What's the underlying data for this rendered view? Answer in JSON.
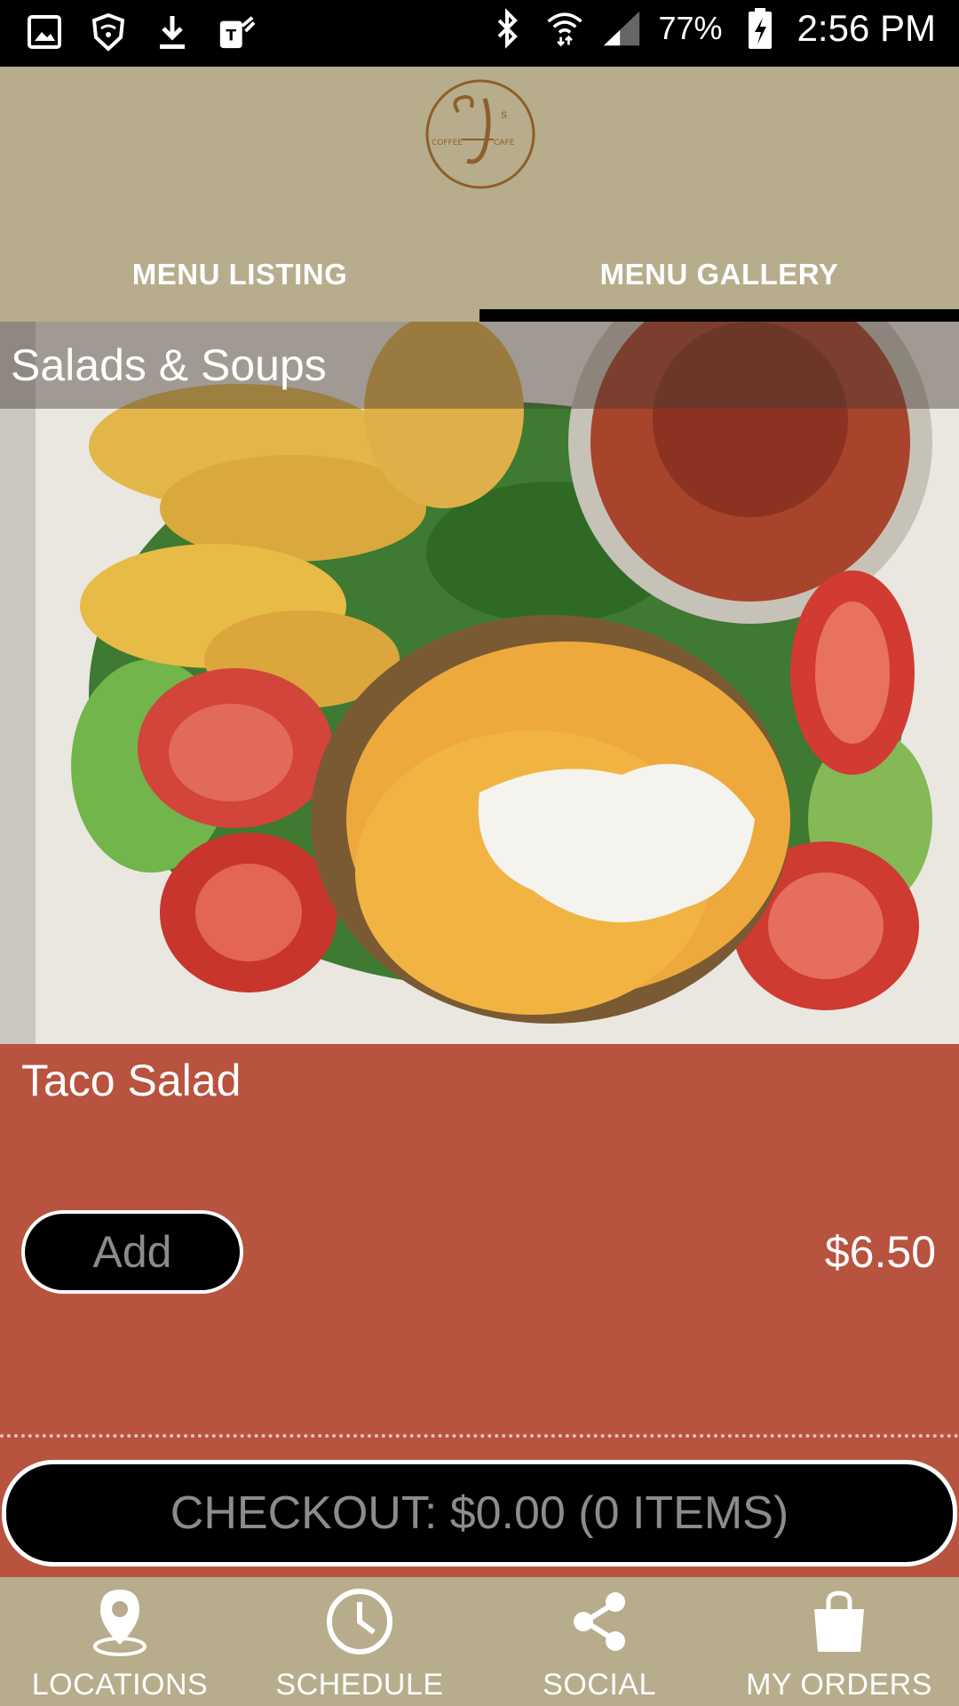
{
  "status_bar": {
    "battery": "77%",
    "time": "2:56 PM"
  },
  "header": {
    "logo_alt": "CJ's Coffee Cafe",
    "tabs": [
      {
        "label": "MENU LISTING",
        "active": false
      },
      {
        "label": "MENU GALLERY",
        "active": true
      }
    ]
  },
  "gallery": {
    "category": "Salads & Soups",
    "item_name": "Taco Salad",
    "add_label": "Add",
    "price": "$6.50"
  },
  "checkout": {
    "label": "CHECKOUT: $0.00 (0 ITEMS)"
  },
  "bottom_nav": [
    {
      "label": "LOCATIONS",
      "icon": "location-pin-icon"
    },
    {
      "label": "SCHEDULE",
      "icon": "clock-icon"
    },
    {
      "label": "SOCIAL",
      "icon": "share-icon"
    },
    {
      "label": "MY ORDERS",
      "icon": "shopping-bag-icon"
    }
  ],
  "colors": {
    "header_bg": "#b7ad8c",
    "details_bg": "#b7533f",
    "accent_dark": "#000000"
  }
}
